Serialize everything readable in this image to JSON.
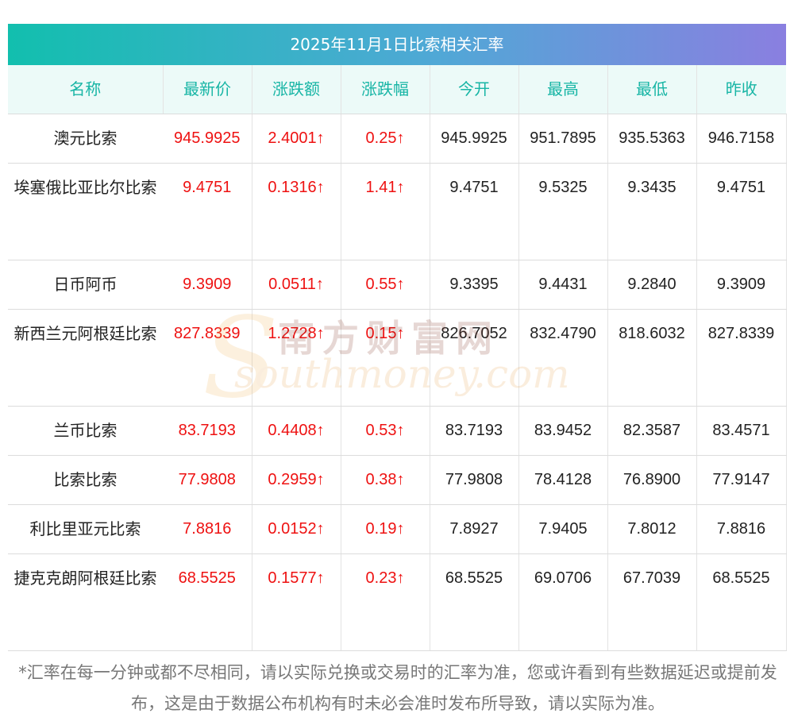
{
  "title": "2025年11月1日比索相关汇率",
  "columns": [
    "名称",
    "最新价",
    "涨跌额",
    "涨跌幅",
    "今开",
    "最高",
    "最低",
    "昨收"
  ],
  "rows": [
    {
      "name": "澳元比索",
      "latest": "945.9925",
      "change": "2.4001↑",
      "pct": "0.25↑",
      "open": "945.9925",
      "high": "951.7895",
      "low": "935.5363",
      "prev": "946.7158"
    },
    {
      "name": "埃塞俄比亚比尔比索",
      "latest": "9.4751",
      "change": "0.1316↑",
      "pct": "1.41↑",
      "open": "9.4751",
      "high": "9.5325",
      "low": "9.3435",
      "prev": "9.4751"
    },
    {
      "name": "日币阿币",
      "latest": "9.3909",
      "change": "0.0511↑",
      "pct": "0.55↑",
      "open": "9.3395",
      "high": "9.4431",
      "low": "9.2840",
      "prev": "9.3909"
    },
    {
      "name": "新西兰元阿根廷比索",
      "latest": "827.8339",
      "change": "1.2728↑",
      "pct": "0.15↑",
      "open": "826.7052",
      "high": "832.4790",
      "low": "818.6032",
      "prev": "827.8339"
    },
    {
      "name": "兰币比索",
      "latest": "83.7193",
      "change": "0.4408↑",
      "pct": "0.53↑",
      "open": "83.7193",
      "high": "83.9452",
      "low": "82.3587",
      "prev": "83.4571"
    },
    {
      "name": "比索比索",
      "latest": "77.9808",
      "change": "0.2959↑",
      "pct": "0.38↑",
      "open": "77.9808",
      "high": "78.4128",
      "low": "76.8900",
      "prev": "77.9147"
    },
    {
      "name": "利比里亚元比索",
      "latest": "7.8816",
      "change": "0.0152↑",
      "pct": "0.19↑",
      "open": "7.8927",
      "high": "7.9405",
      "low": "7.8012",
      "prev": "7.8816"
    },
    {
      "name": "捷克克朗阿根廷比索",
      "latest": "68.5525",
      "change": "0.1577↑",
      "pct": "0.23↑",
      "open": "68.5525",
      "high": "69.0706",
      "low": "67.7039",
      "prev": "68.5525"
    }
  ],
  "watermark": {
    "cn": "南方财富网",
    "en": "southmoney.com"
  },
  "note": "*汇率在每一分钟或都不尽相同，请以实际兑换或交易时的汇率为准，您或许看到有些数据延迟或提前发布，这是由于数据公布机构有时未必会准时发布所导致，请以实际为准。",
  "colors": {
    "accent_teal": "#17b5a5",
    "up_red": "#ee1111",
    "header_bg": "#ecfaf8"
  }
}
